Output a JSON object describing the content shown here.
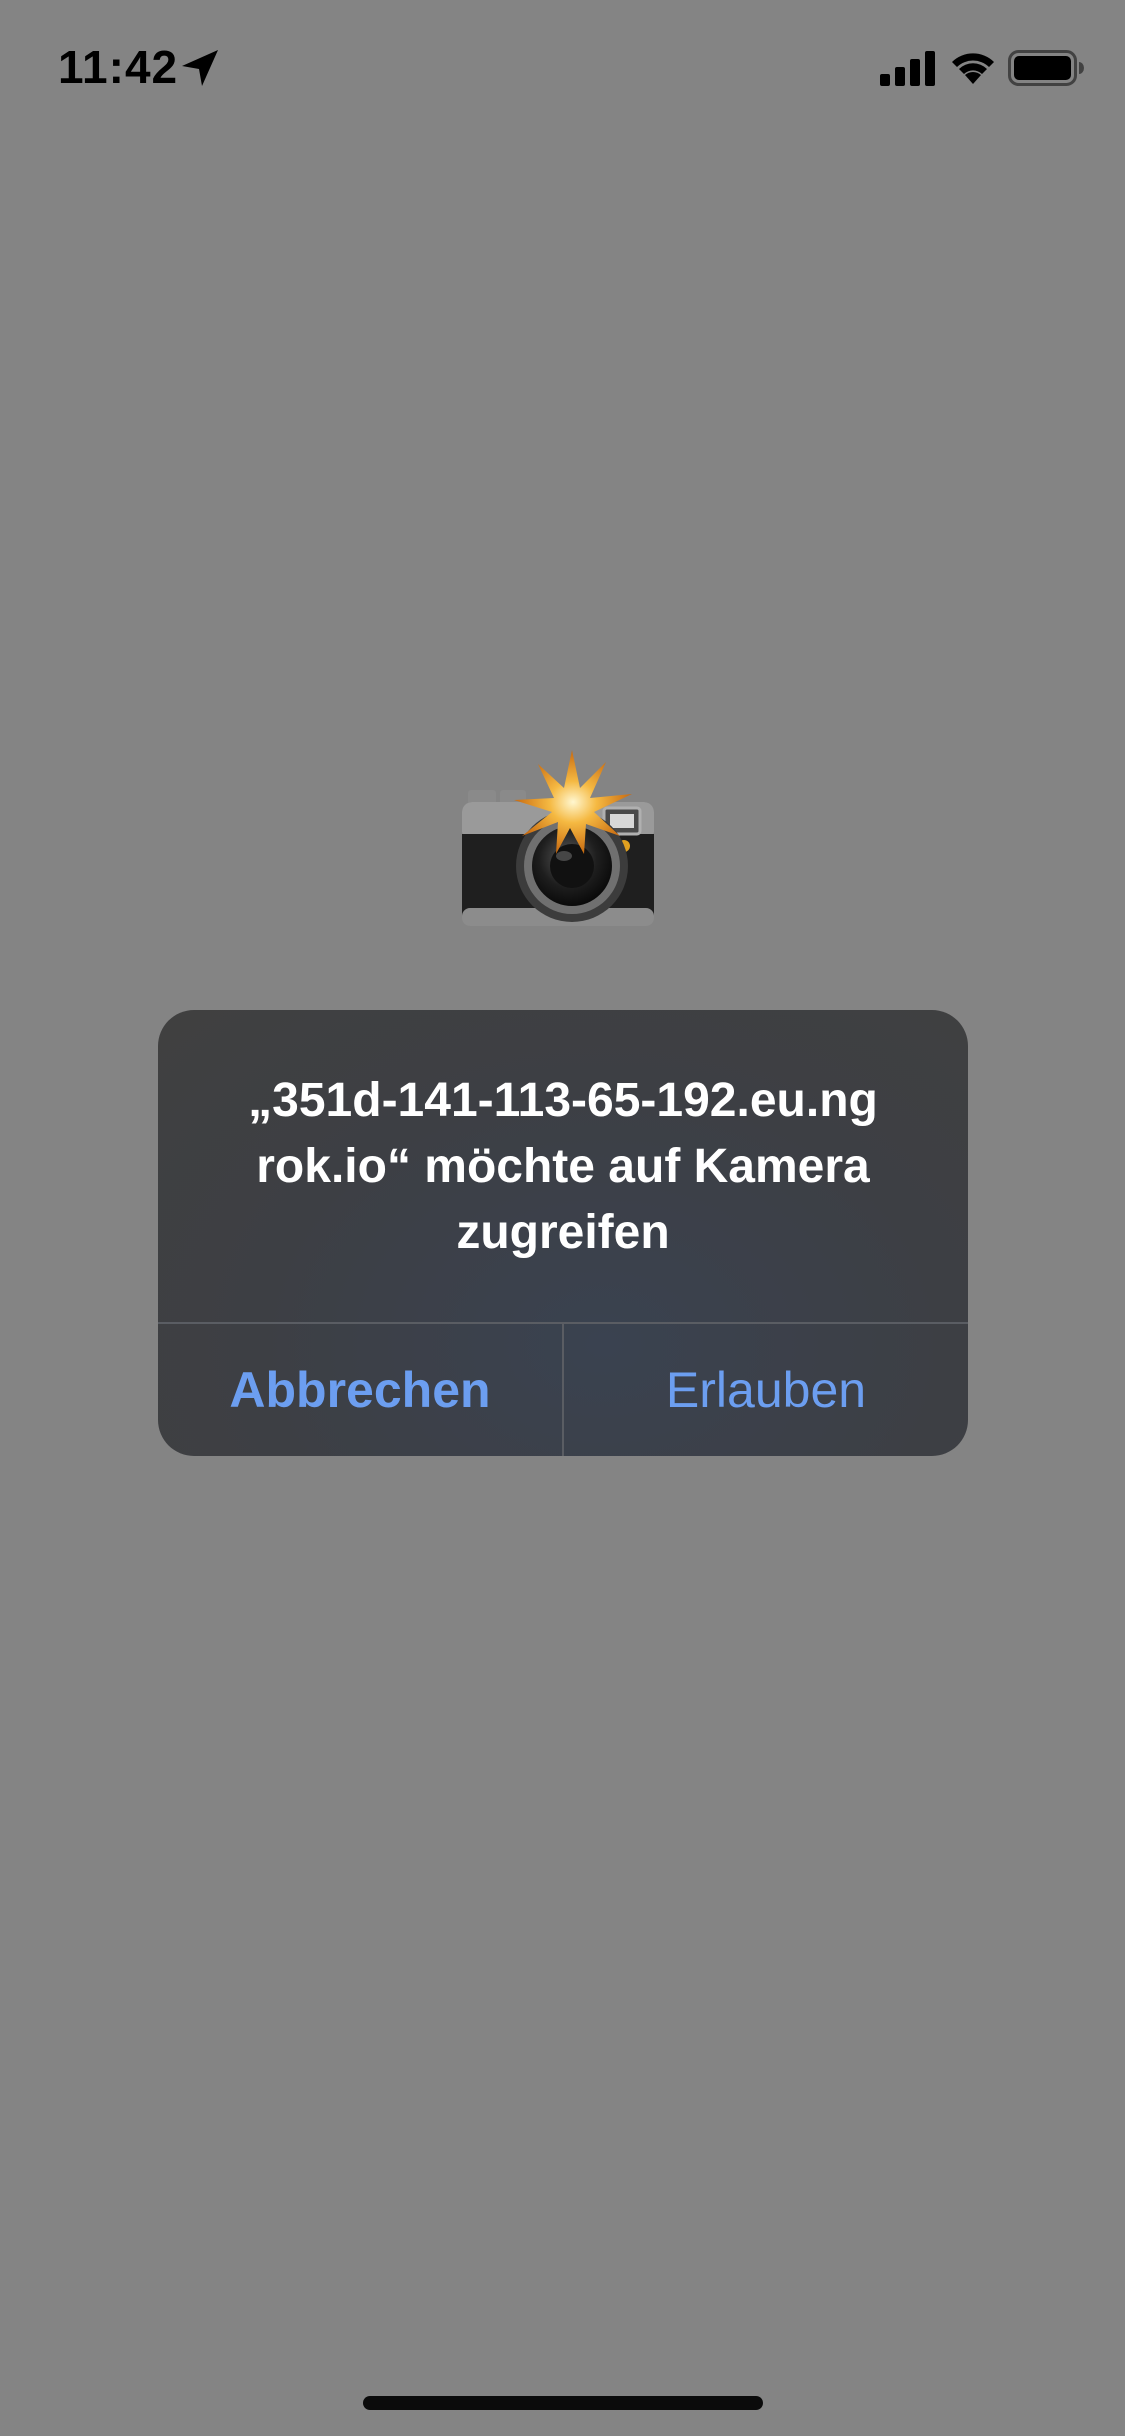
{
  "status_bar": {
    "time": "11:42",
    "icons": [
      "location-arrow-icon",
      "cellular-signal-icon",
      "wifi-icon",
      "battery-icon"
    ]
  },
  "illustration": {
    "icon": "camera-with-flash-icon"
  },
  "alert": {
    "message": "„351d-141-113-65-192.eu.ng\nrok.io“ möchte auf Kamera\nzugreifen",
    "cancel_label": "Abbrechen",
    "allow_label": "Erlauben"
  },
  "colors": {
    "background": "#848484",
    "alert_bg": "#3d3f44",
    "button_text": "#6c9ef0",
    "divider": "#5a5d63"
  }
}
